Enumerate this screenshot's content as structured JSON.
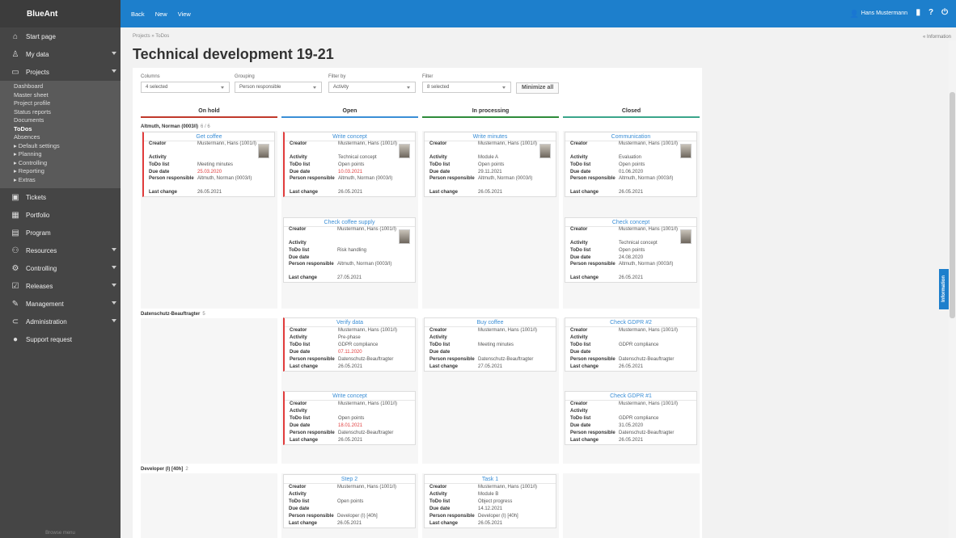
{
  "app": {
    "logo": "BlueAnt"
  },
  "toolbar": {
    "back": "Back",
    "new": "New",
    "view": "View",
    "user": "Hans Mustermann"
  },
  "sidebar": {
    "items_top": [
      {
        "label": "Start page",
        "icon": "home-icon",
        "arrow": false
      },
      {
        "label": "My data",
        "icon": "person-icon",
        "arrow": true
      },
      {
        "label": "Projects",
        "icon": "folder-icon",
        "arrow": true
      }
    ],
    "project_sub": [
      "Dashboard",
      "Master sheet",
      "Project profile",
      "Status reports",
      "Documents",
      "ToDos",
      "Absences",
      "▸ Default settings",
      "▸ Planning",
      "▸ Controlling",
      "▸ Reporting",
      "▸ Extras"
    ],
    "items_bottom": [
      {
        "label": "Tickets",
        "icon": "ticket-icon",
        "arrow": false
      },
      {
        "label": "Portfolio",
        "icon": "portfolio-icon",
        "arrow": false
      },
      {
        "label": "Program",
        "icon": "program-icon",
        "arrow": false
      },
      {
        "label": "Resources",
        "icon": "resources-icon",
        "arrow": true
      },
      {
        "label": "Controlling",
        "icon": "controlling-icon",
        "arrow": true
      },
      {
        "label": "Releases",
        "icon": "releases-icon",
        "arrow": true
      },
      {
        "label": "Management",
        "icon": "management-icon",
        "arrow": true
      },
      {
        "label": "Administration",
        "icon": "administration-icon",
        "arrow": true
      },
      {
        "label": "Support request",
        "icon": "support-icon",
        "arrow": false
      }
    ],
    "browse": "Browse menu"
  },
  "breadcrumb": "Projects » ToDos",
  "info_link": "« Information",
  "page_title": "Technical development 19-21",
  "filters": {
    "columns": {
      "label": "Columns",
      "value": "4 selected"
    },
    "grouping": {
      "label": "Grouping",
      "value": "Person responsible"
    },
    "filterby": {
      "label": "Filter by",
      "value": "Activity"
    },
    "filter": {
      "label": "Filter",
      "value": "8 selected"
    },
    "minimize": "Minimize all"
  },
  "columns": [
    {
      "label": "On hold",
      "color": "#c0392b"
    },
    {
      "label": "Open",
      "color": "#3a8ed6"
    },
    {
      "label": "In processing",
      "color": "#2e8b3a"
    },
    {
      "label": "Closed",
      "color": "#3aa58a"
    }
  ],
  "groups": [
    {
      "name": "Altmuth, Norman (0003/I)",
      "count": "6 / 6"
    },
    {
      "name": "Datenschutz-Beauftragter",
      "count": "5"
    },
    {
      "name": "Developer (I) [40h]",
      "count": "2"
    }
  ],
  "labels": {
    "creator": "Creator",
    "activity": "Activity",
    "todolist": "ToDo list",
    "due": "Due date",
    "person": "Person responsible",
    "last": "Last change"
  },
  "cards": [
    {
      "title": "Get coffee",
      "creator": "Mustermann, Hans (1001/I)",
      "activity": "",
      "todo": "Meeting minutes",
      "due": "25.03.2020",
      "person": "Altmuth, Norman (0003/I)",
      "last": "26.05.2021"
    },
    {
      "title": "Write concept",
      "creator": "Mustermann, Hans (1001/I)",
      "activity": "Technical concept",
      "todo": "Open points",
      "due": "10.03.2021",
      "person": "Altmuth, Norman (0003/I)",
      "last": "26.05.2021"
    },
    {
      "title": "Write minutes",
      "creator": "Mustermann, Hans (1001/I)",
      "activity": "Module A",
      "todo": "Open points",
      "due": "29.11.2021",
      "person": "Altmuth, Norman (0003/I)",
      "last": "26.05.2021"
    },
    {
      "title": "Communication",
      "creator": "Mustermann, Hans (1001/I)",
      "activity": "Evaluation",
      "todo": "Open points",
      "due": "01.06.2020",
      "person": "Altmuth, Norman (0003/I)",
      "last": "26.05.2021"
    },
    {
      "title": "Check coffee supply",
      "creator": "Mustermann, Hans (1001/I)",
      "activity": "",
      "todo": "Risk handling",
      "due": "",
      "person": "Altmuth, Norman (0003/I)",
      "last": "27.05.2021"
    },
    {
      "title": "Check concept",
      "creator": "Mustermann, Hans (1001/I)",
      "activity": "Technical concept",
      "todo": "Open points",
      "due": "24.08.2020",
      "person": "Altmuth, Norman (0003/I)",
      "last": "26.05.2021"
    },
    {
      "title": "Verify data",
      "creator": "Mustermann, Hans (1001/I)",
      "activity": "Pre-phase",
      "todo": "GDPR compliance",
      "due": "07.11.2020",
      "person": "Datenschutz-Beauftragter",
      "last": "26.05.2021"
    },
    {
      "title": "Buy coffee",
      "creator": "Mustermann, Hans (1001/I)",
      "activity": "",
      "todo": "Meeting minutes",
      "due": "",
      "person": "Datenschutz-Beauftragter",
      "last": "27.05.2021"
    },
    {
      "title": "Check GDPR #2",
      "creator": "Mustermann, Hans (1001/I)",
      "activity": "",
      "todo": "GDPR compliance",
      "due": "",
      "person": "Datenschutz-Beauftragter",
      "last": "26.05.2021"
    },
    {
      "title": "Write concept",
      "creator": "Mustermann, Hans (1001/I)",
      "activity": "",
      "todo": "Open points",
      "due": "18.01.2021",
      "person": "Datenschutz-Beauftragter",
      "last": "26.05.2021"
    },
    {
      "title": "Check GDPR #1",
      "creator": "Mustermann, Hans (1001/I)",
      "activity": "",
      "todo": "GDPR compliance",
      "due": "31.05.2020",
      "person": "Datenschutz-Beauftragter",
      "last": "26.05.2021"
    },
    {
      "title": "Step 2",
      "creator": "Mustermann, Hans (1001/I)",
      "activity": "",
      "todo": "Open points",
      "due": "",
      "person": "Developer (I) [40h]",
      "last": "26.05.2021"
    },
    {
      "title": "Task 1",
      "creator": "Mustermann, Hans (1001/I)",
      "activity": "Module B",
      "todo": "Object progress",
      "due": "14.12.2021",
      "person": "Developer (I) [40h]",
      "last": "26.05.2021"
    }
  ],
  "info_tab": "Information"
}
